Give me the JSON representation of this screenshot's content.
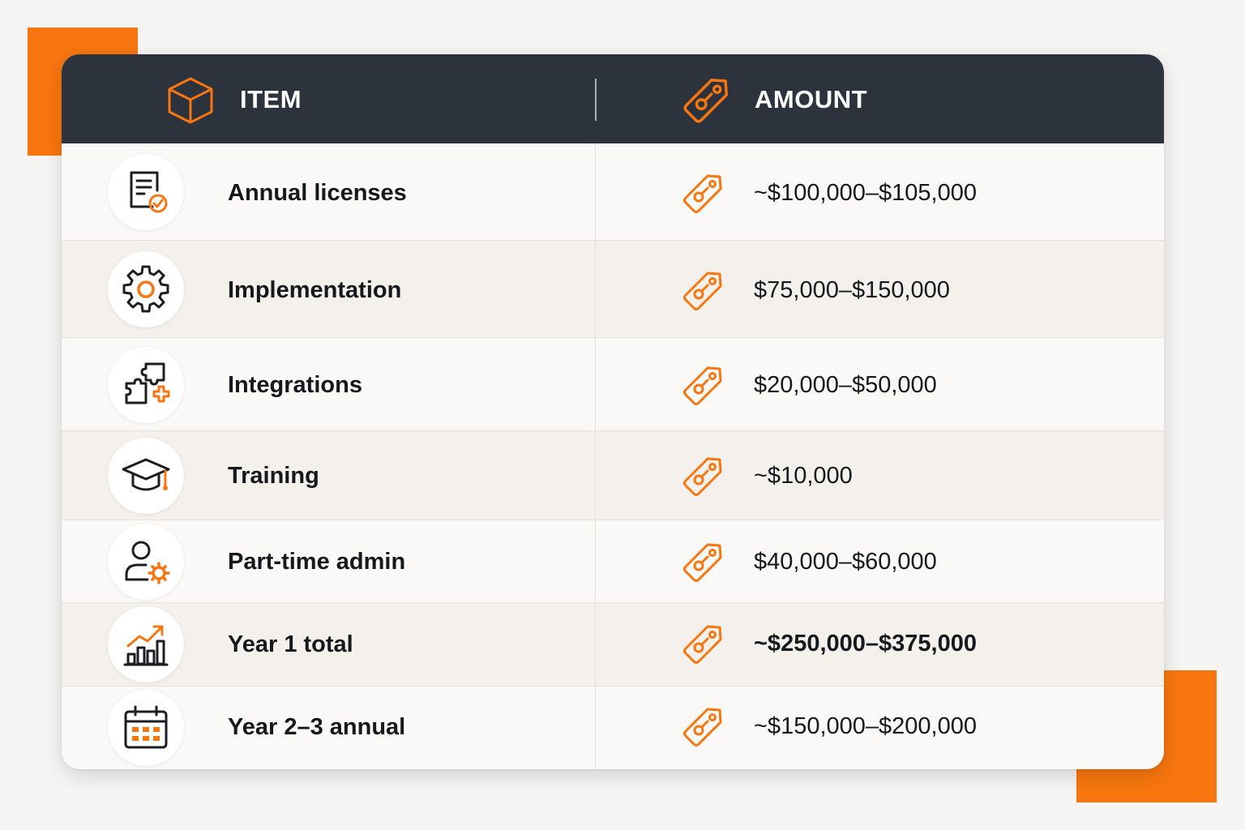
{
  "header": {
    "item_label": "ITEM",
    "amount_label": "AMOUNT",
    "item_icon": "box-icon",
    "amount_icon": "price-tag-icon"
  },
  "colors": {
    "accent": "#f7760f",
    "header_bg": "#2c333c",
    "text": "#15181c"
  },
  "rows": [
    {
      "icon": "license-document-icon",
      "label": "Annual licenses",
      "amount": "~$100,000–$105,000",
      "emphasis": false
    },
    {
      "icon": "gear-icon",
      "label": "Implementation",
      "amount": "$75,000–$150,000",
      "emphasis": false
    },
    {
      "icon": "puzzle-icon",
      "label": "Integrations",
      "amount": "$20,000–$50,000",
      "emphasis": false
    },
    {
      "icon": "graduation-cap-icon",
      "label": "Training",
      "amount": "~$10,000",
      "emphasis": false
    },
    {
      "icon": "user-settings-icon",
      "label": "Part-time admin",
      "amount": "$40,000–$60,000",
      "emphasis": false
    },
    {
      "icon": "growth-chart-icon",
      "label": "Year 1 total",
      "amount": "~$250,000–$375,000",
      "emphasis": true
    },
    {
      "icon": "calendar-icon",
      "label": "Year 2–3 annual",
      "amount": "~$150,000–$200,000",
      "emphasis": false
    }
  ]
}
